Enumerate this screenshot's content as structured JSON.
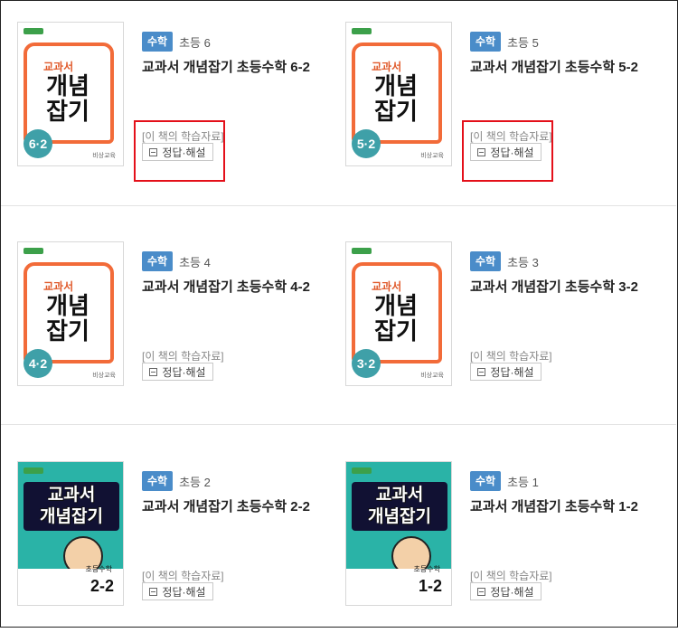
{
  "materials_label": "[이 책의 학습자료]",
  "answer_label": "정답·해설",
  "cover_sub": "교과서",
  "cover_title": "개념잡기",
  "cover_publisher": "비상교육",
  "books": [
    {
      "subject": "수학",
      "grade": "초등 6",
      "title": "교과서 개념잡기 초등수학 6-2",
      "grade_badge": "6·2"
    },
    {
      "subject": "수학",
      "grade": "초등 5",
      "title": "교과서 개념잡기 초등수학 5-2",
      "grade_badge": "5·2"
    },
    {
      "subject": "수학",
      "grade": "초등 4",
      "title": "교과서 개념잡기 초등수학 4-2",
      "grade_badge": "4·2"
    },
    {
      "subject": "수학",
      "grade": "초등 3",
      "title": "교과서 개념잡기 초등수학 3-2",
      "grade_badge": "3·2"
    },
    {
      "subject": "수학",
      "grade": "초등 2",
      "title": "교과서 개념잡기 초등수학 2-2",
      "grade_badge": "2-2",
      "grade_line": "초등수학"
    },
    {
      "subject": "수학",
      "grade": "초등 1",
      "title": "교과서 개념잡기 초등수학 1-2",
      "grade_badge": "1-2",
      "grade_line": "초등수학"
    }
  ]
}
